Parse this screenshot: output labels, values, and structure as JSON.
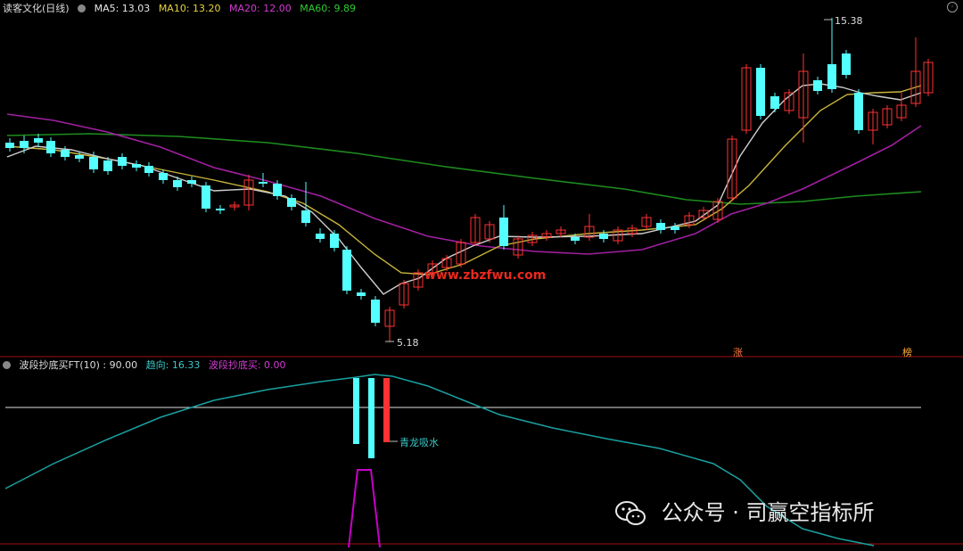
{
  "main_panel": {
    "title": "读客文化(日线)",
    "ma_labels": [
      {
        "key": "ma5",
        "text": "MA5: 13.03",
        "color": "#e8e8e8"
      },
      {
        "key": "ma10",
        "text": "MA10: 13.20",
        "color": "#e6d23c"
      },
      {
        "key": "ma20",
        "text": "MA20: 12.00",
        "color": "#d23cd2"
      },
      {
        "key": "ma60",
        "text": "MA60: 9.89",
        "color": "#2ecc2e"
      }
    ],
    "high_label": "15.38",
    "low_label": "5.18",
    "watermark_url": "www.zbzfwu.com",
    "markers": [
      "涨",
      "榜"
    ]
  },
  "sub_panel": {
    "title": "波段抄底买FT(10) : 90.00",
    "trend": "趋向: 16.33",
    "signal": "波段抄底买: 0.00",
    "annotation": "青龙吸水"
  },
  "footer_watermark": "公众号 · 司赢空指标所",
  "colors": {
    "up": "#ff3232",
    "down": "#54ffff",
    "ma5": "#cfcfcf",
    "ma10": "#c8b43c",
    "ma20": "#a020a0",
    "ma60": "#1e8c1e",
    "trend": "#1aa0a0",
    "signal": "#c800c8"
  },
  "icons": [
    "circle-dot-icon",
    "wechat-icon",
    "settings-icon"
  ]
}
